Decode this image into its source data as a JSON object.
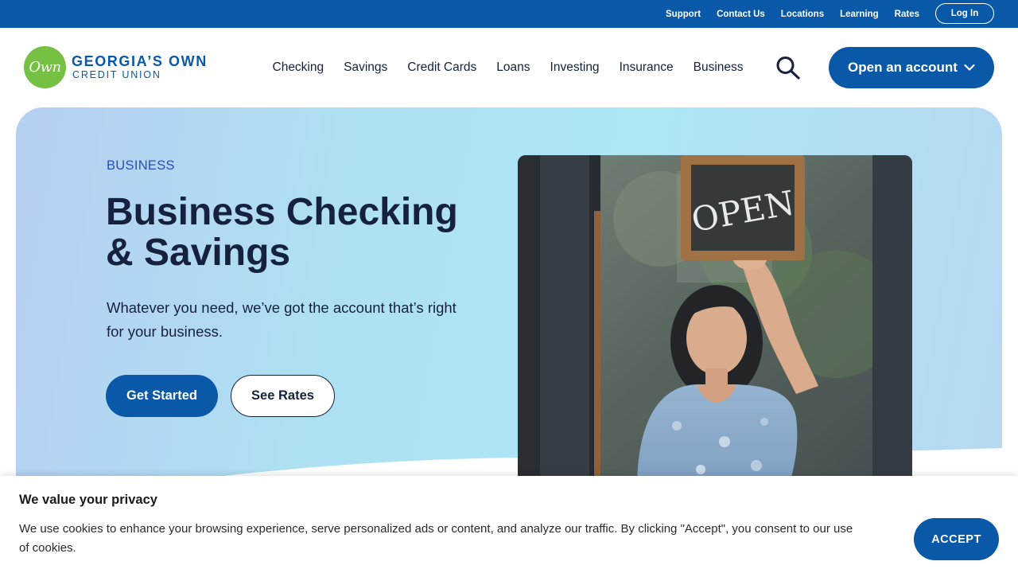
{
  "utility_nav": {
    "links": [
      "Support",
      "Contact Us",
      "Locations",
      "Learning",
      "Rates"
    ],
    "login_label": "Log In"
  },
  "logo": {
    "badge_text": "Own",
    "line1": "GEORGIA’S OWN",
    "line2": "CREDIT UNION"
  },
  "main_nav": {
    "items": [
      "Checking",
      "Savings",
      "Credit Cards",
      "Loans",
      "Investing",
      "Insurance",
      "Business"
    ],
    "search_icon": "search-icon",
    "open_account_label": "Open an account"
  },
  "hero": {
    "eyebrow": "BUSINESS",
    "title": "Business Checking & Savings",
    "subtitle": "Whatever you need, we’ve got the account that’s right for your business.",
    "primary_button": "Get Started",
    "secondary_button": "See Rates",
    "photo_sign_text": "OPEN"
  },
  "cookie_banner": {
    "title": "We value your privacy",
    "text": "We use cookies to enhance your browsing experience, serve personalized ads or content, and analyze our traffic. By clicking \"Accept\", you consent to our use of cookies.",
    "accept_label": "ACCEPT"
  },
  "colors": {
    "brand_blue": "#0a58a8",
    "brand_green": "#76c043",
    "text_dark": "#15213f",
    "eyebrow_blue": "#2450b8"
  }
}
